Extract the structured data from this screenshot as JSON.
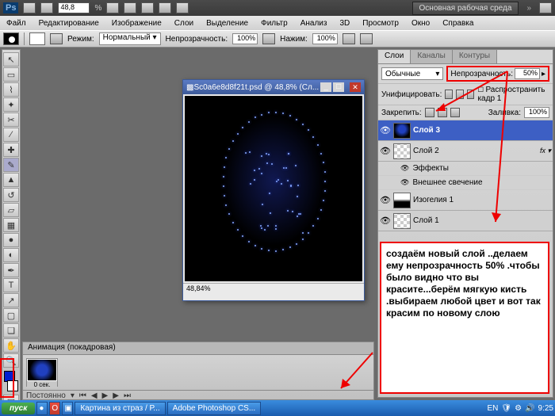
{
  "titlebar": {
    "app": "Ps",
    "zoom": "48,8",
    "workspace_btn": "Основная рабочая среда"
  },
  "menu": [
    "Файл",
    "Редактирование",
    "Изображение",
    "Слои",
    "Выделение",
    "Фильтр",
    "Анализ",
    "3D",
    "Просмотр",
    "Окно",
    "Справка"
  ],
  "optbar": {
    "mode_lbl": "Режим:",
    "mode_val": "Нормальный",
    "opacity_lbl": "Непрозрачность:",
    "opacity_val": "100%",
    "flow_lbl": "Нажим:",
    "flow_val": "100%"
  },
  "doc": {
    "title": "Sc0a6e8d8f21t.psd @ 48,8% (Сл...",
    "status": "48,84%"
  },
  "panels": {
    "tabs": [
      "Слои",
      "Каналы",
      "Контуры"
    ],
    "blend_mode": "Обычные",
    "opacity_lbl": "Непрозрачность:",
    "opacity_val": "50%",
    "unify_lbl": "Унифицировать:",
    "propagate": "Распространить кадр 1",
    "lock_lbl": "Закрепить:",
    "fill_lbl": "Заливка:",
    "fill_val": "100%",
    "layers": [
      {
        "name": "Слой 3",
        "selected": true,
        "thumb": "face"
      },
      {
        "name": "Слой 2",
        "selected": false,
        "thumb": "checker",
        "fx": true
      },
      {
        "name": "Изогелия 1",
        "selected": false,
        "thumb": "bw"
      },
      {
        "name": "Слой 1",
        "selected": false,
        "thumb": "checker"
      }
    ],
    "fx_label": "Эффекты",
    "fx_item": "Внешнее свечение"
  },
  "annotation": "создаём новый слой ..делаем ему непрозрачность 50% .чтобы было видно что вы красите...берём мягкую кисть .выбираем любой цвет и вот так красим по новому слою",
  "anim": {
    "title": "Анимация (покадровая)",
    "frame_time": "0 сек.",
    "loop": "Постоянно"
  },
  "taskbar": {
    "start": "пуск",
    "tasks": [
      "Картина из страз / Р...",
      "Adobe Photoshop CS..."
    ],
    "lang": "EN",
    "time": "9:25"
  },
  "icons": {
    "eye": "👁",
    "chevron": "▾",
    "close": "✕",
    "play": "▶"
  }
}
